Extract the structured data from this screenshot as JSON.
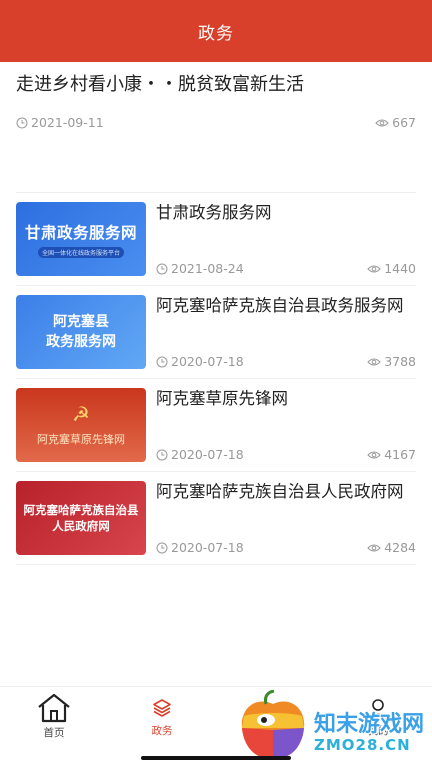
{
  "header": {
    "title": "政务"
  },
  "featured": {
    "title": "走进乡村看小康・・脱贫致富新生活",
    "date": "2021-09-11",
    "views": "667"
  },
  "items": [
    {
      "title": "甘肃政务服务网",
      "date": "2021-08-24",
      "views": "1440",
      "thumb_text": "甘肃政务服务网",
      "thumb_sub": "全国一体化在线政务服务平台"
    },
    {
      "title": "阿克塞哈萨克族自治县政务服务网",
      "date": "2020-07-18",
      "views": "3788",
      "thumb_line1": "阿克塞县",
      "thumb_line2": "政务服务网"
    },
    {
      "title": "阿克塞草原先锋网",
      "date": "2020-07-18",
      "views": "4167",
      "thumb_text": "阿克塞草原先锋网"
    },
    {
      "title": "阿克塞哈萨克族自治县人民政府网",
      "date": "2020-07-18",
      "views": "4284",
      "thumb_line1": "阿克塞哈萨克族自治县",
      "thumb_line2": "人民政府网"
    }
  ],
  "tabbar": {
    "tabs": [
      {
        "label": "首页",
        "icon": "home-icon"
      },
      {
        "label": "政务",
        "icon": "cube-icon"
      },
      {
        "label": "",
        "icon": ""
      },
      {
        "label": "我的",
        "icon": "user-icon"
      }
    ],
    "active_color": "#d9402b"
  },
  "watermark": {
    "text1": "知末游戏网",
    "text2": "ZMO28.CN"
  },
  "colors": {
    "brand": "#d9402b",
    "meta": "#999999"
  }
}
